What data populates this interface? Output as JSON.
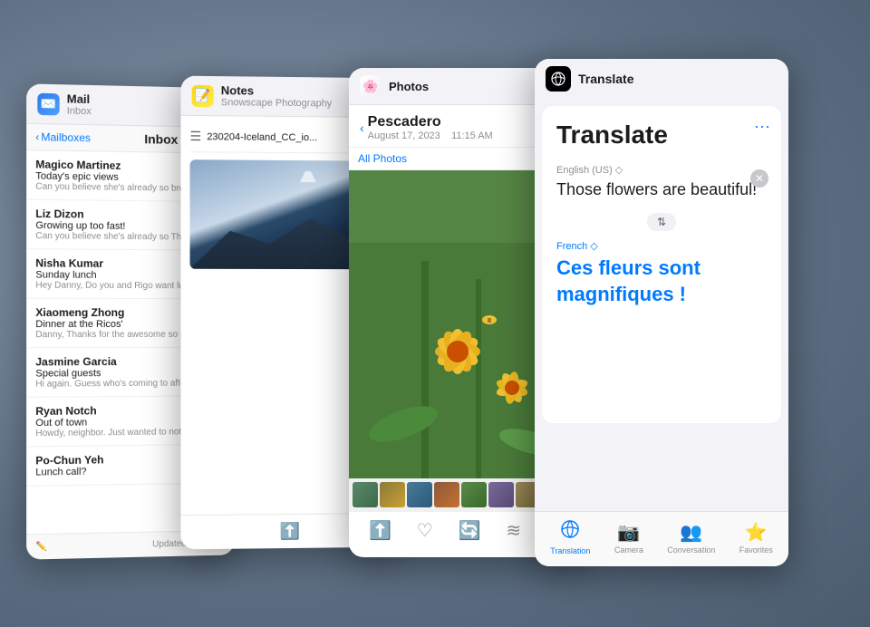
{
  "background": {
    "color": "#6b7c8f"
  },
  "mail_card": {
    "title": "Mail",
    "subtitle": "Inbox",
    "icon": "✉️",
    "toolbar": {
      "back_label": "Mailboxes",
      "inbox_label": "Inbox"
    },
    "emails": [
      {
        "sender": "Magico Martinez",
        "subject": "Today's epic views",
        "preview": "Can you believe she's already so breathtaking day in the mountain..."
      },
      {
        "sender": "Liz Dizon",
        "subject": "Growing up too fast!",
        "preview": "Can you believe she's already so Thanks for the bubbles."
      },
      {
        "sender": "Nisha Kumar",
        "subject": "Sunday lunch",
        "preview": "Hey Danny, Do you and Rigo want lunch on Sunday to meet my da..."
      },
      {
        "sender": "Xiaomeng Zhong",
        "subject": "Dinner at the Ricos'",
        "preview": "Danny, Thanks for the awesome so much fun that I only rememb..."
      },
      {
        "sender": "Jasmine Garcia",
        "subject": "Special guests",
        "preview": "Hi again. Guess who's coming to after all? These two always kno..."
      },
      {
        "sender": "Ryan Notch",
        "subject": "Out of town",
        "preview": "Howdy, neighbor. Just wanted to note to let you know we're leav..."
      },
      {
        "sender": "Po-Chun Yeh",
        "subject": "Lunch call?",
        "preview": ""
      }
    ],
    "footer": {
      "updated": "Updated Just Now"
    }
  },
  "notes_card": {
    "title": "Notes",
    "subtitle": "Snowscape Photography",
    "icon": "📝",
    "doc_item": "230204-Iceland_CC_io..."
  },
  "photos_card": {
    "title": "Photos",
    "icon": "🌸",
    "location": "Pescadero",
    "date": "August 17, 2023",
    "time": "11:15 AM",
    "all_photos_label": "All Photos",
    "more_label": "···",
    "footer_icons": [
      "share",
      "heart",
      "rotate",
      "filter",
      "trash"
    ]
  },
  "translate_card": {
    "title": "Translate",
    "icon": "🌐",
    "main_title": "Translate",
    "source_lang": "English (US) ◇",
    "source_text": "Those flowers are beautiful!",
    "target_lang": "French ◇",
    "target_text": "Ces fleurs sont magnifiques !",
    "more_icon": "···",
    "tabs": [
      {
        "label": "Translation",
        "icon": "🌐",
        "active": true
      },
      {
        "label": "Camera",
        "icon": "📷",
        "active": false
      },
      {
        "label": "Conversation",
        "icon": "👥",
        "active": false
      },
      {
        "label": "Favorites",
        "icon": "⭐",
        "active": false
      }
    ]
  }
}
